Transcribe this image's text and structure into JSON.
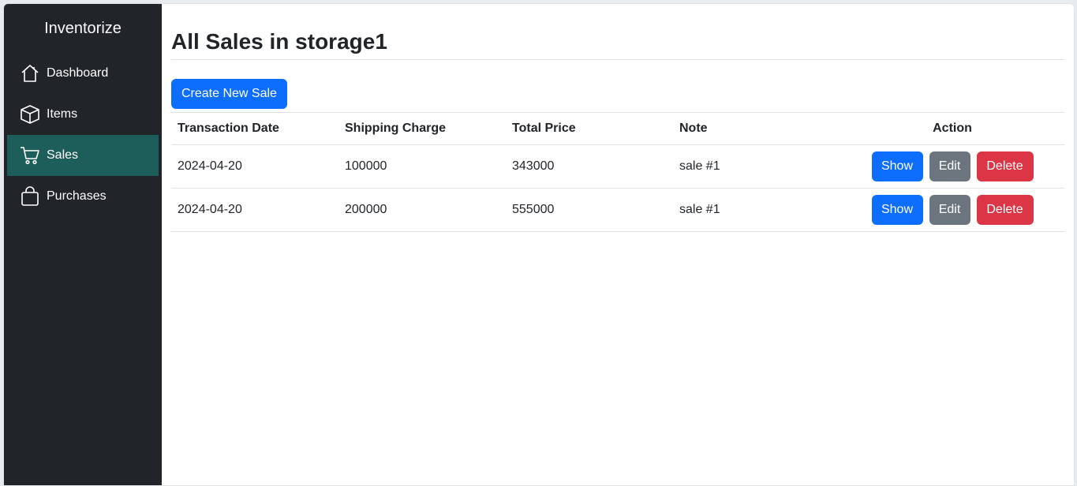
{
  "sidebar": {
    "brand": "Inventorize",
    "items": [
      {
        "label": "Dashboard",
        "icon": "house-icon",
        "active": false
      },
      {
        "label": "Items",
        "icon": "box-icon",
        "active": false
      },
      {
        "label": "Sales",
        "icon": "cart-icon",
        "active": true
      },
      {
        "label": "Purchases",
        "icon": "bag-icon",
        "active": false
      }
    ],
    "active_color": "#1e5e5a"
  },
  "main": {
    "title": "All Sales in storage1",
    "create_button": "Create New Sale",
    "table": {
      "headers": {
        "date": "Transaction Date",
        "shipping": "Shipping Charge",
        "total": "Total Price",
        "note": "Note",
        "action": "Action"
      },
      "rows": [
        {
          "date": "2024-04-20",
          "shipping": "100000",
          "total": "343000",
          "note": "sale #1"
        },
        {
          "date": "2024-04-20",
          "shipping": "200000",
          "total": "555000",
          "note": "sale #1"
        }
      ],
      "actions": {
        "show": "Show",
        "edit": "Edit",
        "delete": "Delete"
      }
    }
  },
  "colors": {
    "primary": "#0d6efd",
    "secondary": "#6c757d",
    "danger": "#dc3545",
    "sidebar_bg": "#212529"
  }
}
